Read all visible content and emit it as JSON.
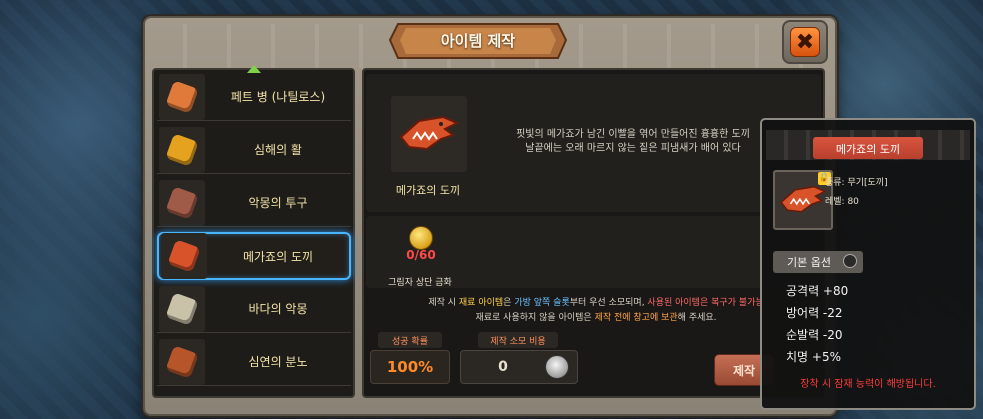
{
  "window": {
    "title": "아이템 제작",
    "close_label": "✖"
  },
  "item_list": [
    {
      "name": "페트 병 (나틸로스)",
      "icon": "bottle-icon",
      "color": "#e07a3a"
    },
    {
      "name": "심해의 활",
      "icon": "bow-icon",
      "color": "#e5a21e"
    },
    {
      "name": "악몽의 투구",
      "icon": "helmet-icon",
      "color": "#a05a48"
    },
    {
      "name": "메가죠의 도끼",
      "icon": "shark-axe-icon",
      "color": "#d8522a"
    },
    {
      "name": "바다의 악몽",
      "icon": "skull-icon",
      "color": "#c9c2a8"
    },
    {
      "name": "심연의 분노",
      "icon": "shield-icon",
      "color": "#b6552a"
    }
  ],
  "selected_index": 3,
  "detail": {
    "name": "메가죠의 도끼",
    "description_line1": "핏빛의 메가죠가 남긴 이빨을 엮어 만들어진 흉흉한 도끼",
    "description_line2": "날끝에는 오래 마르지 않는 짙은 피냄새가 배어 있다"
  },
  "material": {
    "count": "0/60",
    "name": "그림자 상단 금화"
  },
  "warning": {
    "p1": "제작 시 ",
    "p2": "재료 아이템",
    "p3": "은 ",
    "p4": "가방 앞쪽 슬롯",
    "p5": "부터 우선 소모되며, ",
    "p6": "사용된 아이템은 복구가 불가능",
    "line2_a": "재료로 사용하지 않을 아이템은 ",
    "line2_b": "제작 전에 창고에 보관",
    "line2_c": "해 주세요."
  },
  "stats": {
    "success_label": "성공 확률",
    "success_value": "100%",
    "cost_label": "제작 소모 비용",
    "cost_value": "0"
  },
  "craft_button": "제작",
  "tooltip": {
    "name": "메가죠의 도끼",
    "type": "종류: 무기[도끼]",
    "level": "레벨: 80",
    "options_title": "기본 옵션",
    "attack": "공격력 +80",
    "defense": "방어력 -22",
    "agility": "순발력 -20",
    "crit": "치명 +5%",
    "note": "장착 시 잠재 능력이 해방됩니다."
  }
}
